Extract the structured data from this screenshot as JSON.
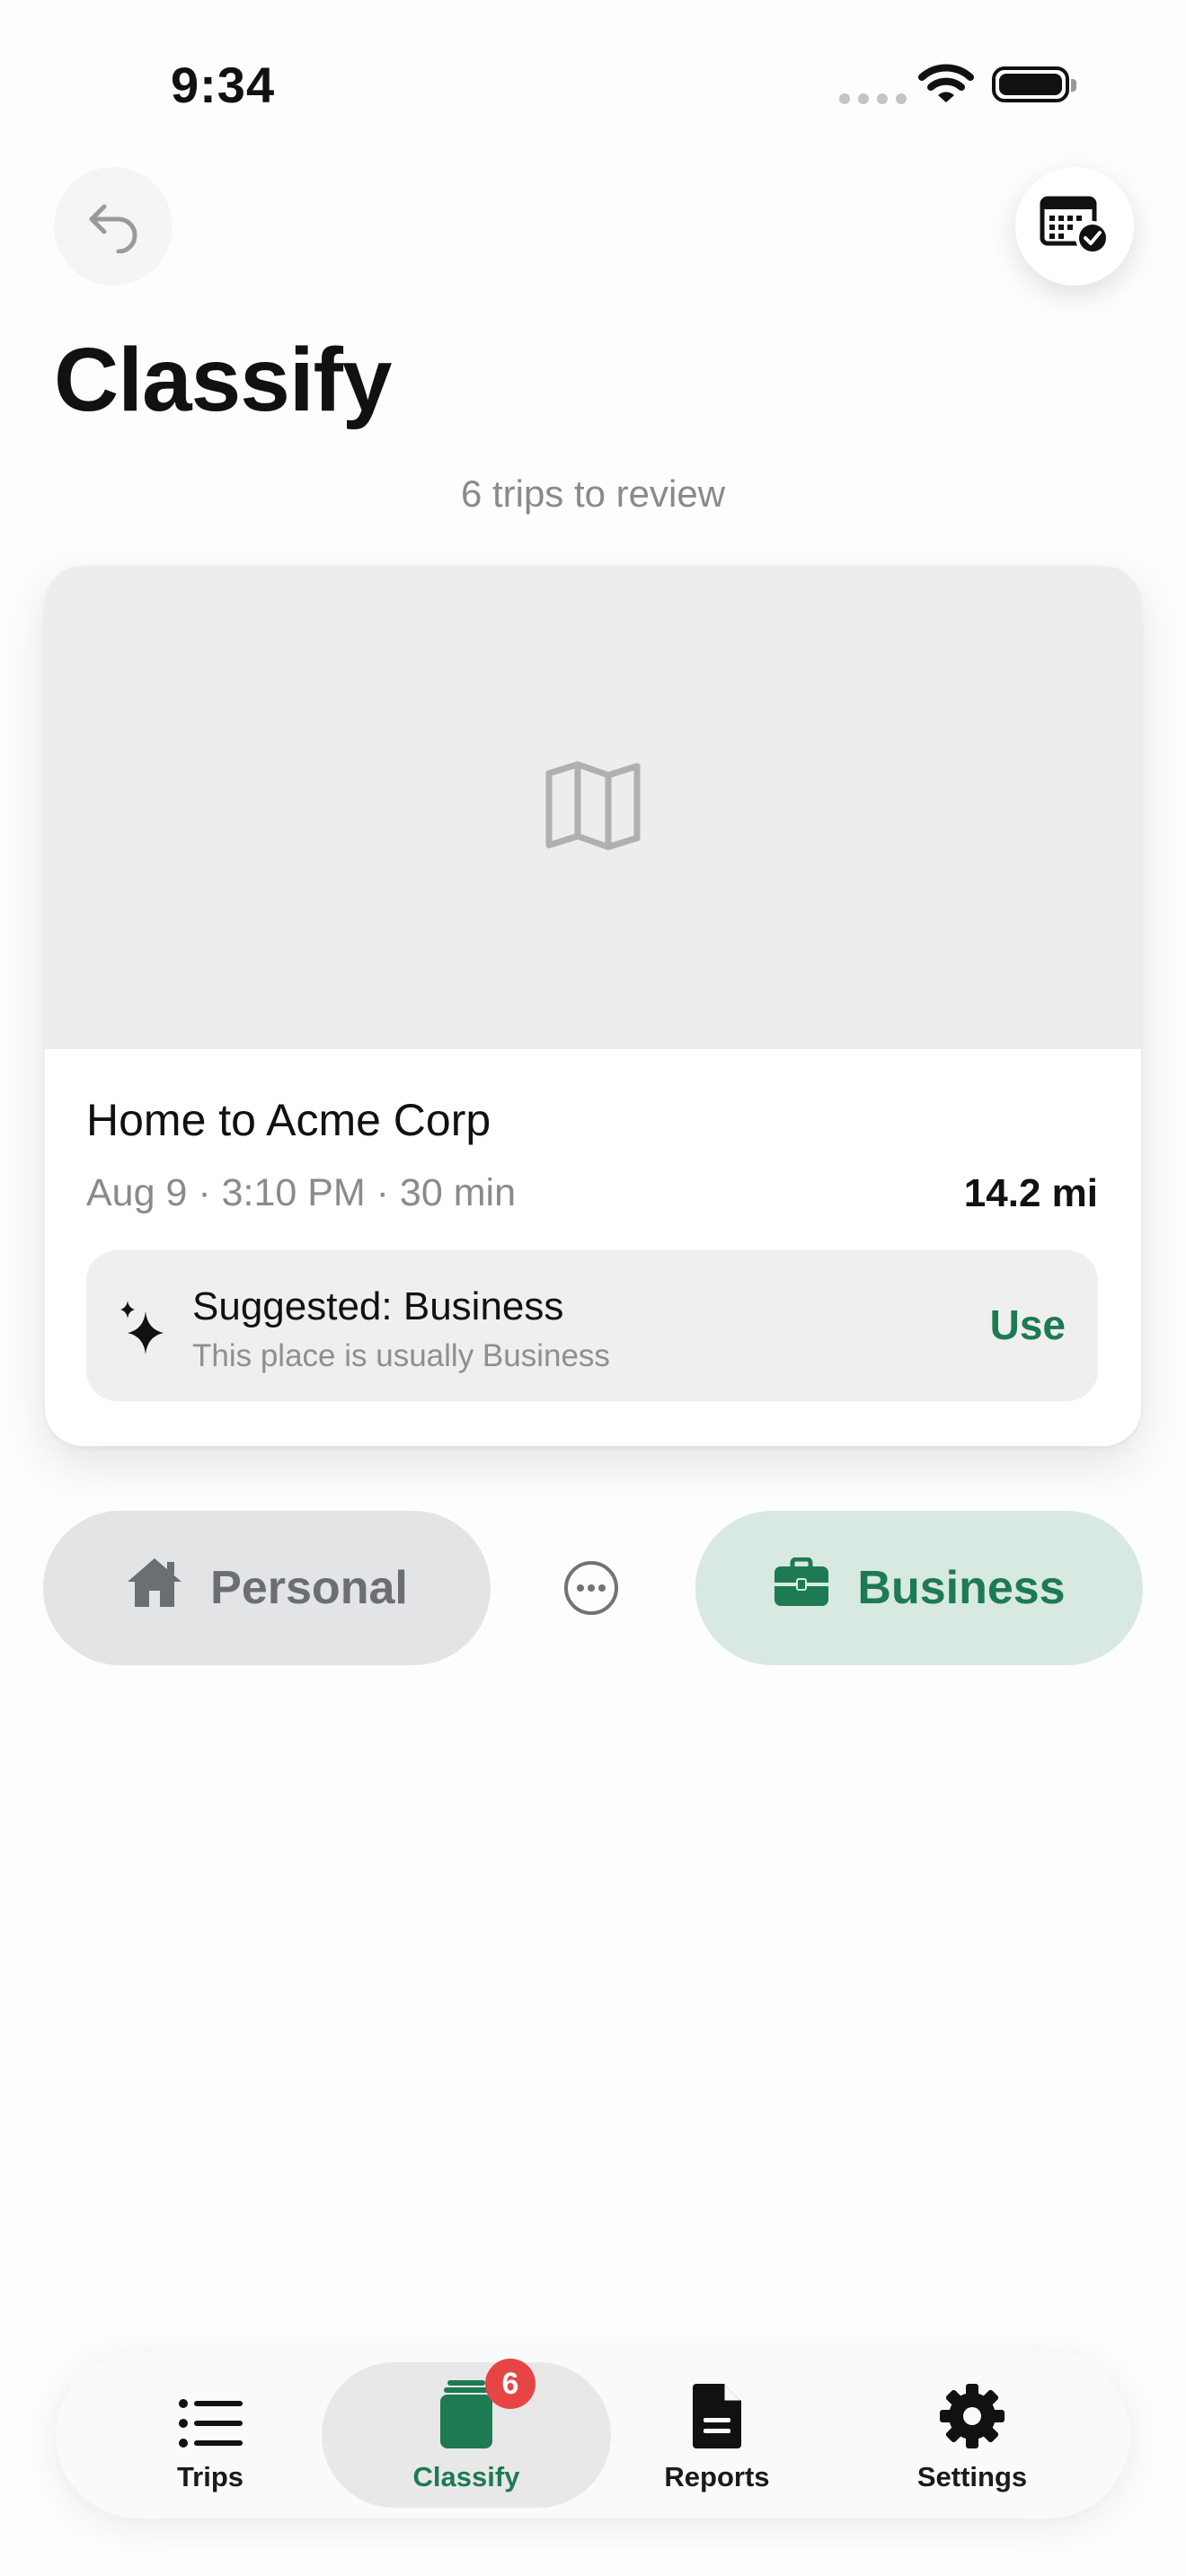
{
  "status_bar": {
    "time": "9:34"
  },
  "header": {
    "title": "Classify",
    "subtitle": "6 trips to review"
  },
  "trip": {
    "title": "Home to Acme Corp",
    "meta": "Aug 9 · 3:10 PM · 30 min",
    "distance": "14.2 mi",
    "suggestion": {
      "title": "Suggested: Business",
      "subtitle": "This place is usually Business",
      "action_label": "Use"
    }
  },
  "actions": {
    "personal_label": "Personal",
    "business_label": "Business"
  },
  "tabbar": {
    "items": [
      {
        "label": "Trips",
        "icon": "list-icon"
      },
      {
        "label": "Classify",
        "icon": "cards-stack-icon",
        "badge": "6"
      },
      {
        "label": "Reports",
        "icon": "document-icon"
      },
      {
        "label": "Settings",
        "icon": "gear-icon"
      }
    ]
  },
  "colors": {
    "accent": "#1e7a52",
    "business_bg": "#d7e9e1",
    "personal_bg": "#e3e4e6",
    "badge": "#e74445"
  }
}
